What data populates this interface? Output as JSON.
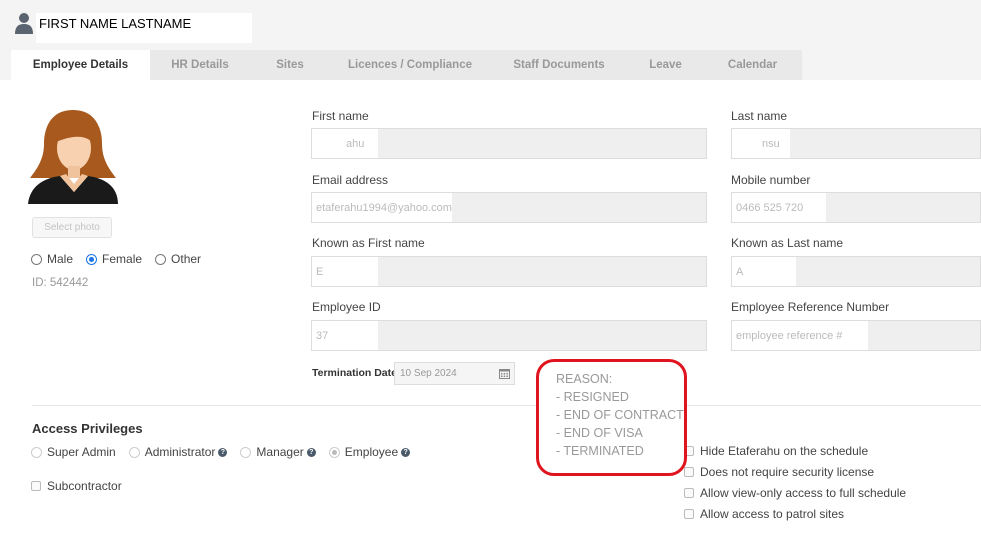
{
  "header": {
    "name": "FIRST NAME LASTNAME"
  },
  "tabs": [
    {
      "label": "Employee Details",
      "active": true
    },
    {
      "label": "HR Details"
    },
    {
      "label": "Sites"
    },
    {
      "label": "Licences / Compliance"
    },
    {
      "label": "Staff Documents"
    },
    {
      "label": "Leave"
    },
    {
      "label": "Calendar"
    }
  ],
  "profile": {
    "select_photo": "Select photo",
    "gender": {
      "options": [
        "Male",
        "Female",
        "Other"
      ],
      "selected": "Female"
    },
    "id": "ID: 542442"
  },
  "fields": {
    "first_name": {
      "label": "First name",
      "value": "ahu"
    },
    "last_name": {
      "label": "Last name",
      "value": "nsu"
    },
    "email": {
      "label": "Email address",
      "value": "etaferahu1994@yahoo.com"
    },
    "mobile": {
      "label": "Mobile number",
      "value": "0466 525 720"
    },
    "known_first": {
      "label": "Known as First name",
      "value": "E"
    },
    "known_last": {
      "label": "Known as Last name",
      "value": "A"
    },
    "employee_id": {
      "label": "Employee ID",
      "value": "37"
    },
    "employee_ref": {
      "label": "Employee Reference Number",
      "placeholder": "employee reference #"
    }
  },
  "termination": {
    "label": "Termination Date",
    "value": "10 Sep 2024"
  },
  "access": {
    "title": "Access Privileges",
    "roles": [
      "Super Admin",
      "Administrator",
      "Manager",
      "Employee"
    ],
    "selected": "Employee",
    "subcontractor": "Subcontractor",
    "options": [
      "Hide Etaferahu on the schedule",
      "Does not require security license",
      "Allow view-only access to full schedule",
      "Allow access to patrol sites"
    ]
  },
  "reason": {
    "title": "REASON:",
    "items": [
      "- RESIGNED",
      "- END OF CONTRACT",
      "- END OF VISA",
      "- TERMINATED"
    ]
  },
  "colors": {
    "accent": "#1a73e8",
    "annotation": "#e0141e"
  }
}
